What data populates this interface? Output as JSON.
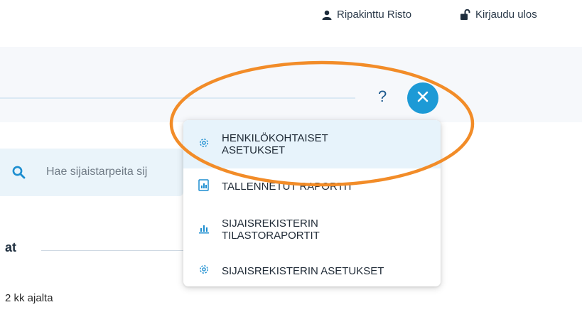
{
  "header": {
    "user_name": "Ripakinttu Risto",
    "logout_label": "Kirjaudu ulos"
  },
  "toolbar": {
    "help_label": "?",
    "close_icon": "close-icon"
  },
  "search": {
    "placeholder": "Hae sijaistarpeita sij"
  },
  "section": {
    "heading": "at",
    "text": "2 kk ajalta"
  },
  "menu": {
    "items": [
      {
        "label_line1": "HENKILÖKOHTAISET",
        "label_line2": "ASETUKSET",
        "icon": "gear-icon",
        "active": true
      },
      {
        "label_line1": "TALLENNETUT RAPORTIT",
        "label_line2": "",
        "icon": "report-icon",
        "active": false
      },
      {
        "label_line1": "SIJAISREKISTERIN",
        "label_line2": "TILASTORAPORTIT",
        "icon": "bar-chart-icon",
        "active": false
      },
      {
        "label_line1": "SIJAISREKISTERIN ASETUKSET",
        "label_line2": "",
        "icon": "gear-icon",
        "active": false
      }
    ]
  },
  "colors": {
    "accent": "#1d9ad6",
    "menu_active_bg": "#e7f3fb",
    "annotation": "#f28c28"
  }
}
